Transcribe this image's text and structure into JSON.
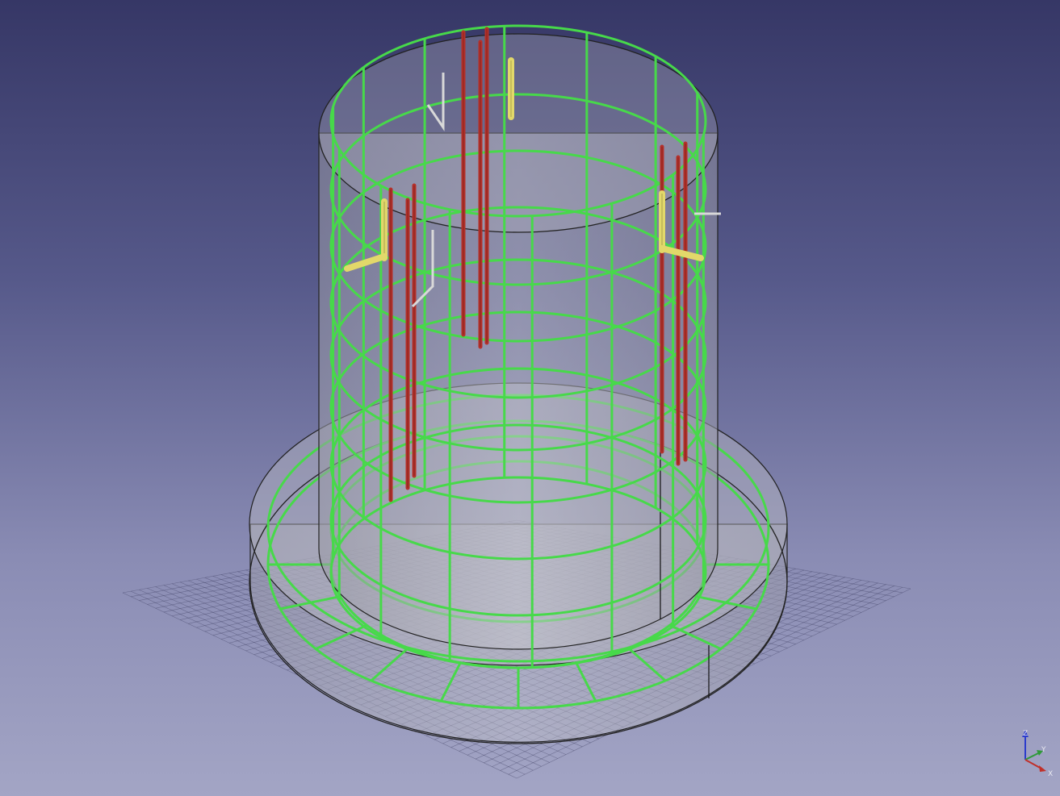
{
  "window": {
    "view": "3D viewport",
    "background_top": "#363766",
    "background_bottom": "#a3a5c5"
  },
  "model": {
    "description_visible": "",
    "rebar_color": "#47d94a",
    "dowel_color": "#b5302a",
    "pipe_color": "#e2d86a",
    "wire_color": "#d8d8d8",
    "solid_color": "#bfbfbf"
  },
  "axis_indicator": {
    "x_label": "X",
    "y_label": "Y",
    "z_label": "Z",
    "x_color": "#c0302a",
    "y_color": "#2f9a3a",
    "z_color": "#2c3ccc"
  }
}
